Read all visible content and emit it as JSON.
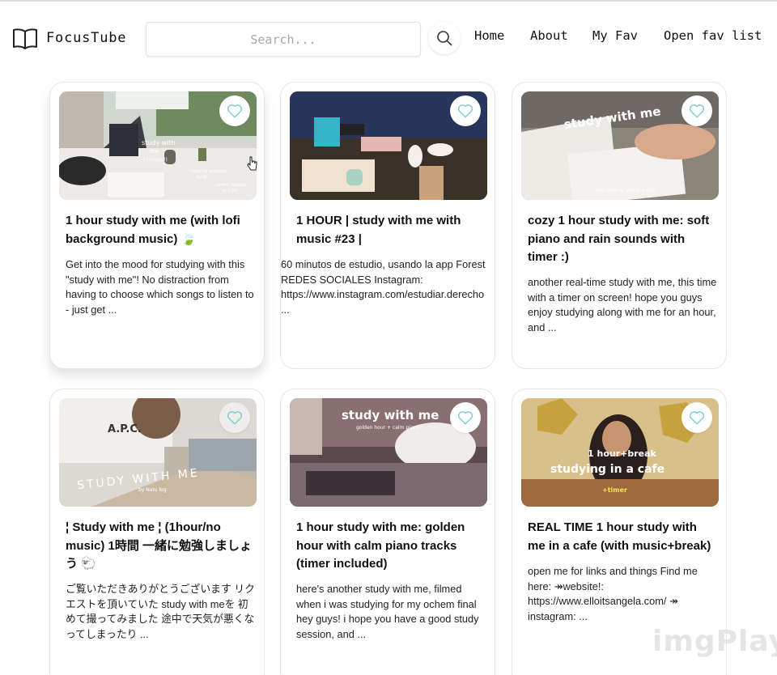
{
  "brand": {
    "name": "FocusTube"
  },
  "search": {
    "placeholder": "Search..."
  },
  "nav": [
    {
      "label": "Home"
    },
    {
      "label": "About"
    },
    {
      "label": "My Fav"
    },
    {
      "label": "Open fav list"
    }
  ],
  "colors": {
    "heart": "#7fcfcf",
    "card_border": "#e6e6e6"
  },
  "icons": {
    "logo": "book-icon",
    "search": "search-icon",
    "favorite": "heart-icon"
  },
  "cards": [
    {
      "title": "1 hour study with me (with lofi background music) 🍃",
      "description": "Get into the mood for studying with this \"study with me\"! No distraction from having to choose which songs to listen to - just get ...",
      "thumb_text": [
        "study with",
        "me",
        "(+music!)",
        "listening asmr/lofi",
        "by @....",
        "current reading",
        "at 1:58"
      ]
    },
    {
      "title": "1 HOUR | study with me with music #23 |",
      "description": "60 minutos de estudio, usando la app Forest\nREDES SOCIALES Instagram:\nhttps://www.instagram.com/estudiar.derecho\n...",
      "thumb_text": []
    },
    {
      "title": "cozy 1 hour study with me: soft piano and rain sounds with timer :)",
      "description": "another real-time study with me, this time with a timer on screen! hope you guys enjoy studying along with me for an hour, and ...",
      "thumb_text": [
        "study with me",
        "real time w/ piano + rain"
      ]
    },
    {
      "title": "¦ Study with me ¦ (1hour/no music) 1時間 一緒に勉強しましょう 🐑",
      "description": "ご覧いただきありがとうございます リクエストを頂いていた study with meを 初めて撮ってみました 途中で天気が悪くなってしまったり ...",
      "thumb_text": [
        "A.P.C.",
        "STUDY WITH ME",
        "by Natu log"
      ]
    },
    {
      "title": "1 hour study with me: golden hour with calm piano tracks (timer included)",
      "description": "here's another study with me, filmed when i was studying for my ochem final hey guys! i hope you have a good study session, and ...",
      "thumb_text": [
        "study with me",
        "golden hour + calm piano"
      ]
    },
    {
      "title": "REAL TIME 1 hour study with me in a cafe (with music+break)",
      "description": "open me for links and things Find me here: ↠website!: https://www.elloitsangela.com/ ↠ instagram: ...",
      "thumb_text": [
        "1 hour+break",
        "studying in a cafe",
        "+timer"
      ]
    }
  ],
  "watermark": "imgPlay"
}
